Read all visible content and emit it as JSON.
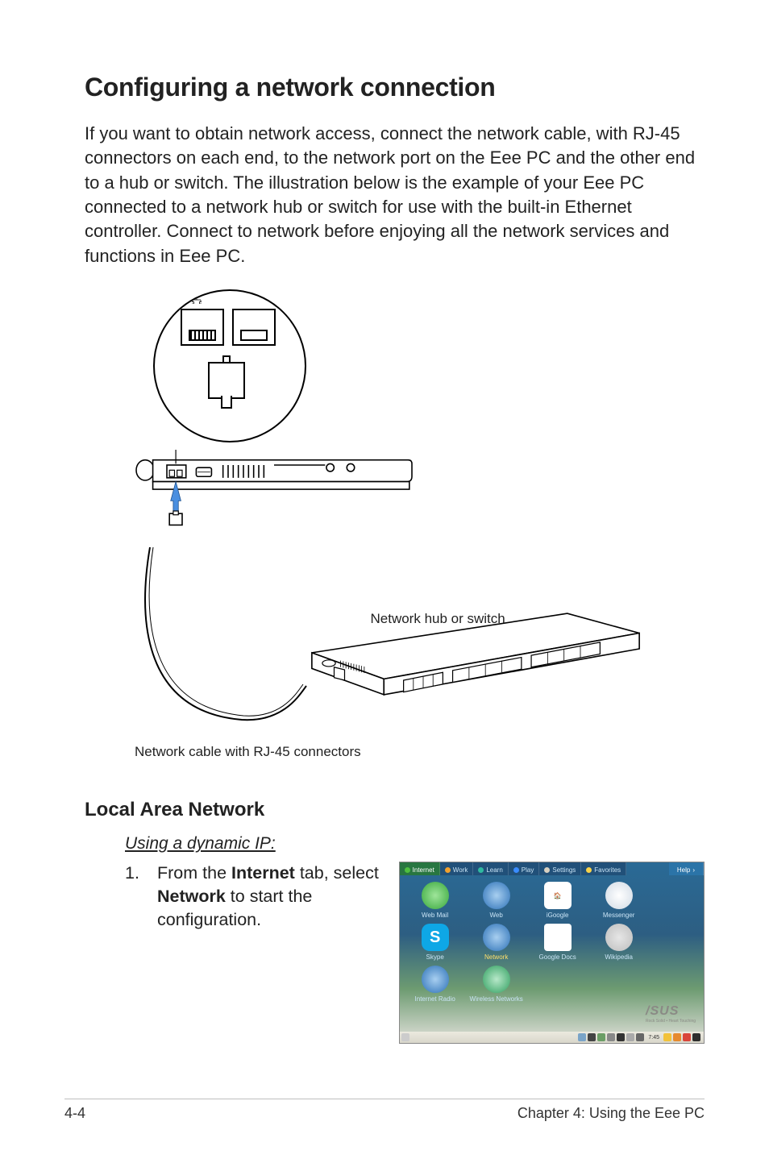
{
  "heading": "Configuring a network connection",
  "intro": "If you want to obtain network access, connect the network cable, with RJ-45 connectors on each end, to the network port on the Eee PC and the other end to a hub or switch. The illustration below is the example of your Eee PC connected to a network hub or switch for use with the built-in Ethernet controller. Connect to network before enjoying all the network services and functions in Eee PC.",
  "diagram": {
    "switch_label": "Network hub or switch",
    "cable_caption": "Network cable with RJ-45 connectors"
  },
  "section_heading": "Local Area Network",
  "subheading": "Using a dynamic IP:",
  "step1": {
    "num": "1.",
    "before": "From the ",
    "bold1": "Internet",
    "mid": " tab, select ",
    "bold2": "Network",
    "after": " to start the configuration."
  },
  "desktop": {
    "tabs": {
      "internet": "Internet",
      "work": "Work",
      "learn": "Learn",
      "play": "Play",
      "settings": "Settings",
      "favorites": "Favorites",
      "help": "Help"
    },
    "icons": {
      "webmail": "Web Mail",
      "web": "Web",
      "igoogle": "iGoogle",
      "messenger": "Messenger",
      "skype": "Skype",
      "network": "Network",
      "googledocs": "Google Docs",
      "wikipedia": "Wikipedia",
      "internetradio": "Internet Radio",
      "wireless": "Wireless Networks"
    },
    "brand": "/SUS",
    "brand_sub": "Rock Solid • Heart Touching",
    "taskbar_time": "7:45",
    "skype_letter": "S"
  },
  "footer": {
    "page": "4-4",
    "chapter": "Chapter 4: Using the Eee PC"
  }
}
